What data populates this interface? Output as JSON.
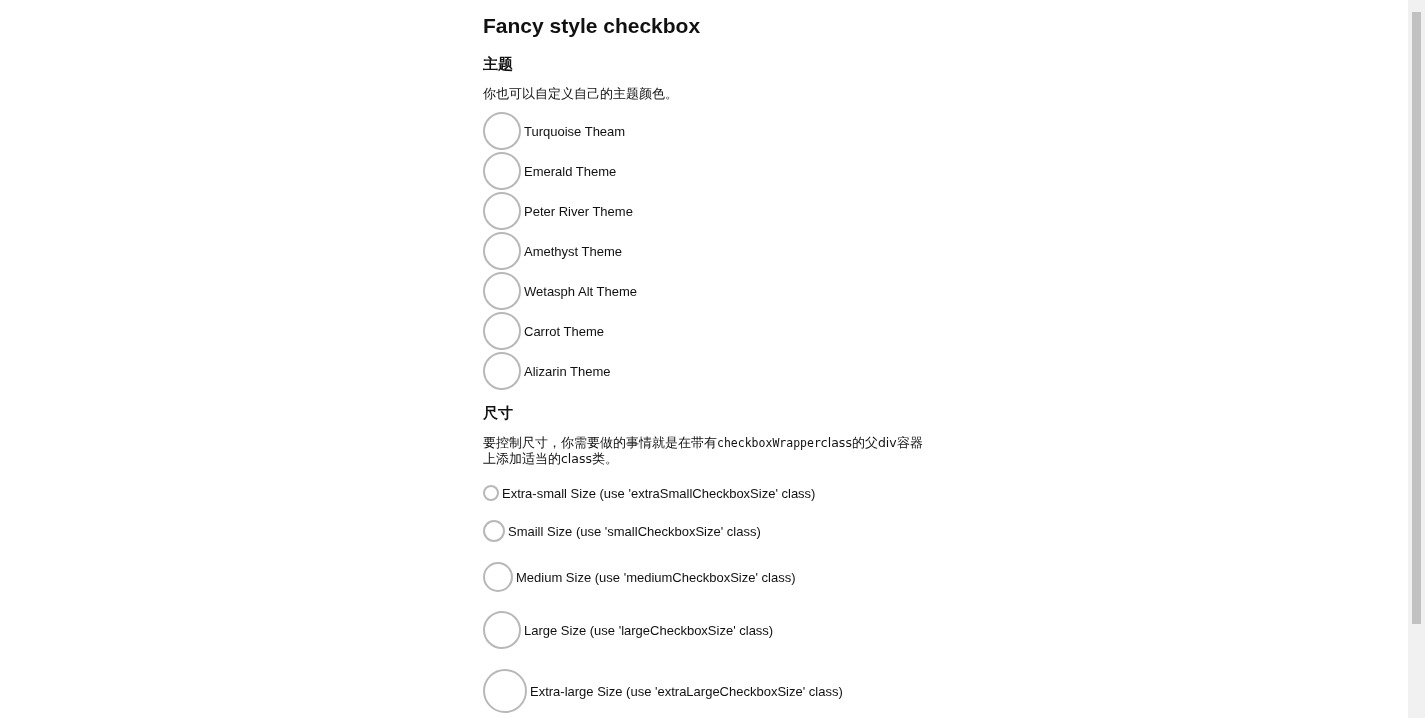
{
  "title": "Fancy style checkbox",
  "theme_section": {
    "heading": "主题",
    "description": "你也可以自定义自己的主题颜色。",
    "options": [
      {
        "label": "Turquoise Theam",
        "checked": false
      },
      {
        "label": "Emerald Theme",
        "checked": false
      },
      {
        "label": "Peter River Theme",
        "checked": false
      },
      {
        "label": "Amethyst Theme",
        "checked": false
      },
      {
        "label": "Wetasph Alt Theme",
        "checked": false
      },
      {
        "label": "Carrot Theme",
        "checked": false
      },
      {
        "label": "Alizarin Theme",
        "checked": false
      }
    ]
  },
  "size_section": {
    "heading": "尺寸",
    "description_parts": [
      {
        "kind": "text",
        "text": "要控制尺寸，你需要做的事情就是在带有"
      },
      {
        "kind": "code",
        "text": "checkboxWrapper"
      },
      {
        "kind": "text",
        "text": "class的父div容器上添加适当的class类。"
      }
    ],
    "options": [
      {
        "kind": "extra-small",
        "label": "Extra-small Size (use 'extraSmallCheckboxSize' class)",
        "checked": false
      },
      {
        "kind": "small",
        "label": "Smaill Size (use 'smallCheckboxSize' class)",
        "checked": false
      },
      {
        "kind": "medium",
        "label": "Medium Size (use 'mediumCheckboxSize' class)",
        "checked": false
      },
      {
        "kind": "large",
        "label": "Large Size (use 'largeCheckboxSize' class)",
        "checked": false
      },
      {
        "kind": "extra-large",
        "label": "Extra-large Size (use 'extraLargeCheckboxSize' class)",
        "checked": false
      }
    ]
  }
}
